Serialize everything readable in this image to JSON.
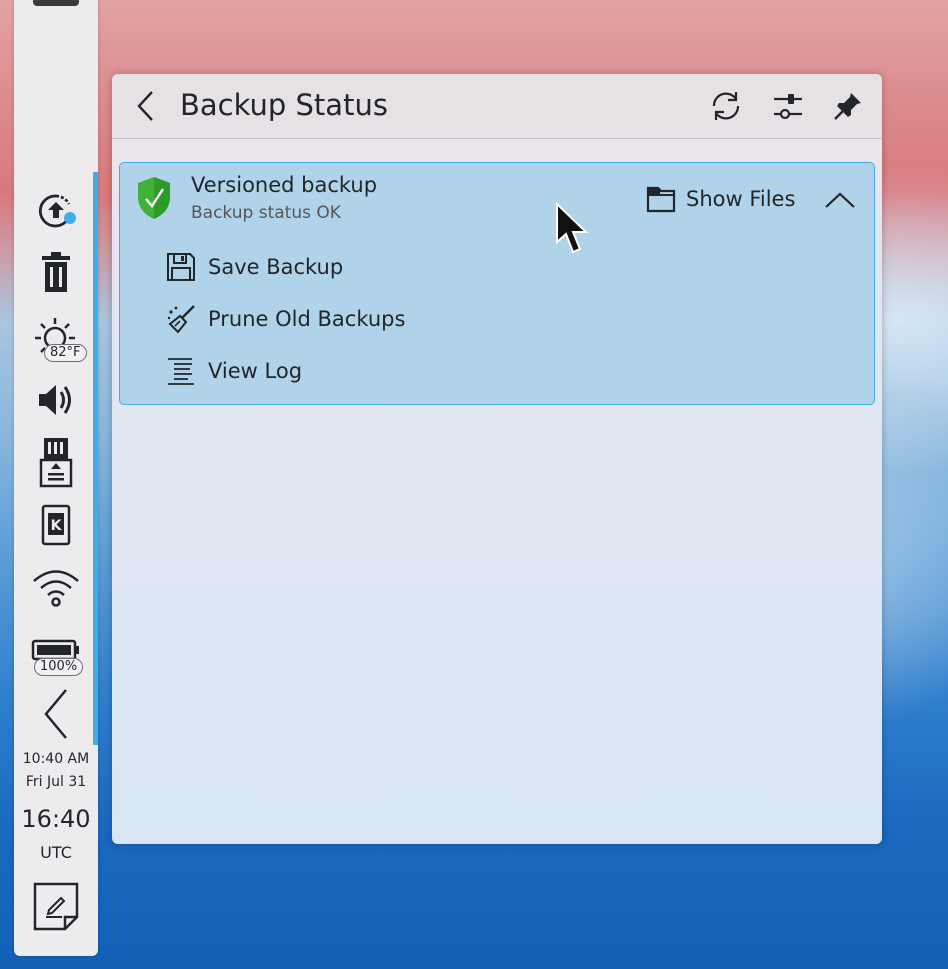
{
  "panel": {
    "weather_badge": "82°F",
    "battery_badge": "100%",
    "clock": {
      "local_time": "10:40 AM",
      "local_date": "Fri Jul 31",
      "utc_time": "16:40",
      "utc_label": "UTC"
    }
  },
  "popup": {
    "title": "Backup Status",
    "item": {
      "title": "Versioned backup",
      "status": "Backup status OK",
      "show_files_label": "Show Files",
      "actions": [
        {
          "label": "Save Backup",
          "icon": "save-icon"
        },
        {
          "label": "Prune Old Backups",
          "icon": "broom-icon"
        },
        {
          "label": "View Log",
          "icon": "log-icon"
        }
      ]
    }
  },
  "colors": {
    "accent": "#3daee9",
    "item_highlight": "#b0d3ea",
    "status_ok_green": "#2ca02c"
  }
}
